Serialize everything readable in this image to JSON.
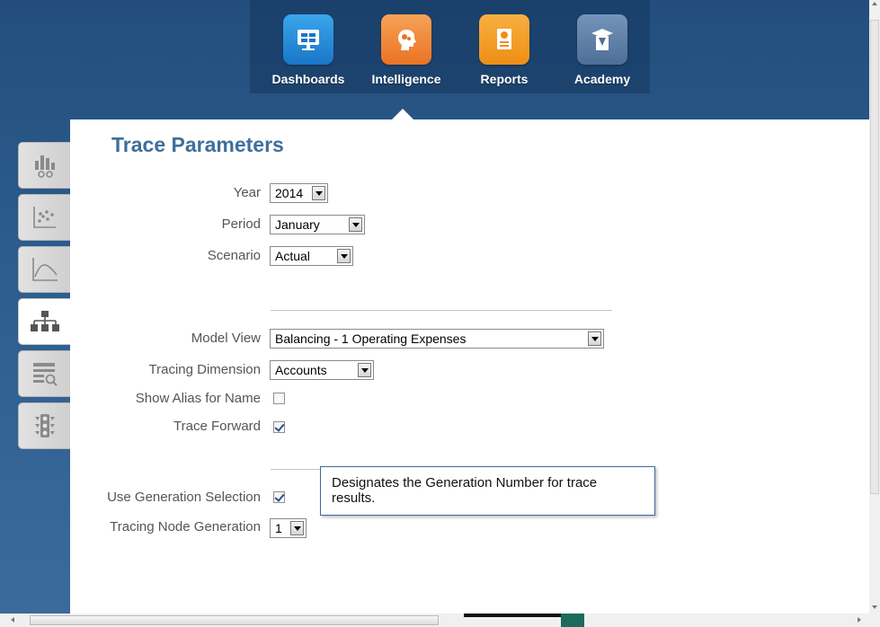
{
  "nav": {
    "items": [
      {
        "label": "Dashboards",
        "icon": "dashboard-monitor-icon",
        "color": "#1e88d8"
      },
      {
        "label": "Intelligence",
        "icon": "intelligence-head-icon",
        "color": "#f08a32"
      },
      {
        "label": "Reports",
        "icon": "reports-document-icon",
        "color": "#f39a1e"
      },
      {
        "label": "Academy",
        "icon": "academy-graduate-icon",
        "color": "#5b7ea6"
      }
    ],
    "active": "Intelligence"
  },
  "sidebar": {
    "tabs": [
      {
        "name": "bar-chart-glasses-icon"
      },
      {
        "name": "scatter-plot-icon"
      },
      {
        "name": "line-curve-icon"
      },
      {
        "name": "hierarchy-icon",
        "active": true
      },
      {
        "name": "report-search-icon"
      },
      {
        "name": "traffic-light-icon"
      }
    ]
  },
  "form": {
    "title": "Trace Parameters",
    "year": {
      "label": "Year",
      "value": "2014"
    },
    "period": {
      "label": "Period",
      "value": "January"
    },
    "scenario": {
      "label": "Scenario",
      "value": "Actual"
    },
    "model_view": {
      "label": "Model View",
      "value": "Balancing - 1 Operating Expenses"
    },
    "tracing_dimension": {
      "label": "Tracing Dimension",
      "value": "Accounts"
    },
    "show_alias": {
      "label": "Show Alias for Name",
      "checked": false
    },
    "trace_forward": {
      "label": "Trace Forward",
      "checked": true
    },
    "use_generation": {
      "label": "Use Generation Selection",
      "checked": true
    },
    "tracing_node_generation": {
      "label": "Tracing Node Generation",
      "value": "1"
    }
  },
  "tooltip": {
    "text": "Designates the Generation Number for trace results."
  },
  "colors": {
    "accent": "#3e6f9c",
    "background": "#2d5d8e"
  }
}
